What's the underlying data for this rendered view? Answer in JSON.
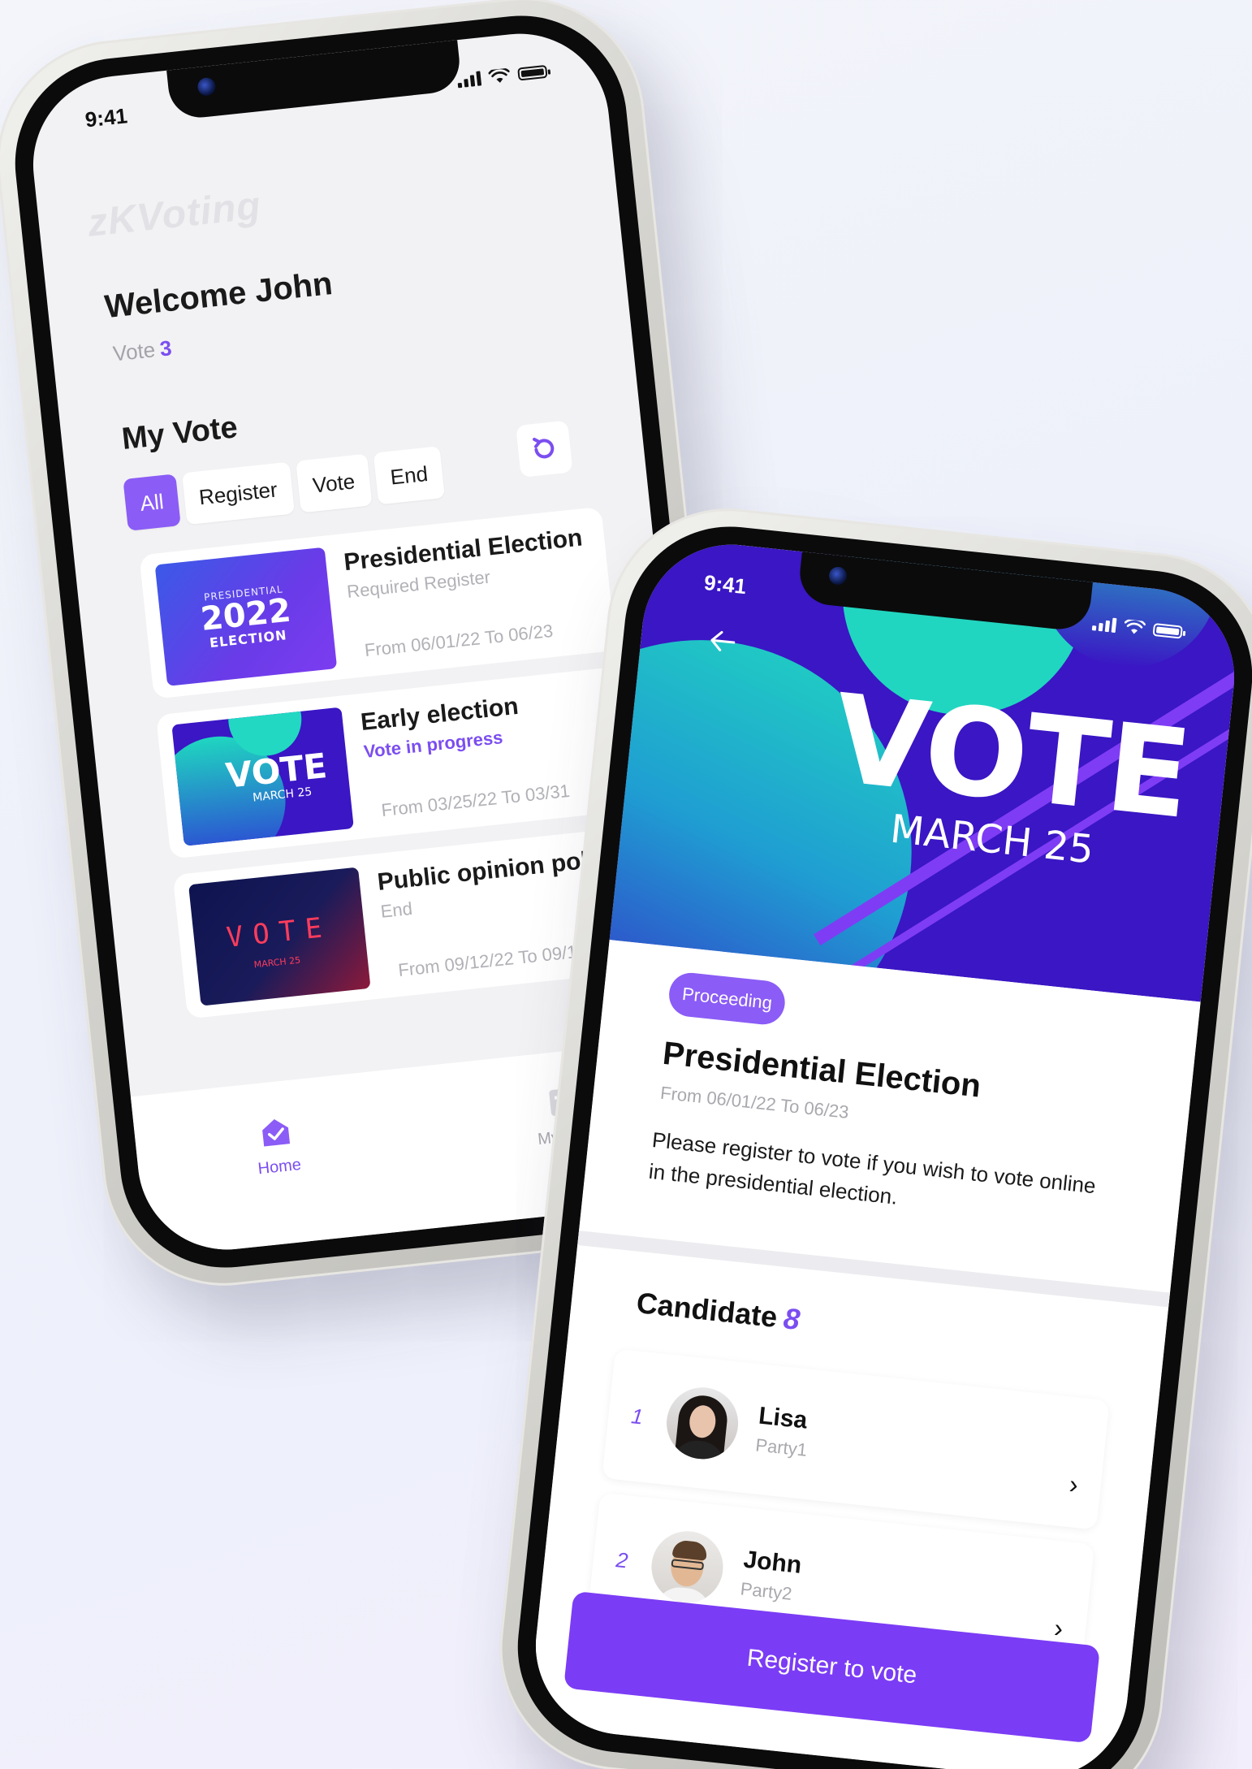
{
  "status_time": "9:41",
  "home": {
    "logo": "zKVoting",
    "welcome": "Welcome John",
    "vote_label": "Vote",
    "vote_count": "3",
    "section_title": "My Vote",
    "filters": [
      "All",
      "Register",
      "Vote",
      "End"
    ],
    "votes": [
      {
        "title": "Presidential Election",
        "status": "Required Register",
        "date": "From 06/01/22 To 06/23",
        "thumb": {
          "line1": "PRESIDENTIAL",
          "line2": "2022",
          "line3": "ELECTION"
        }
      },
      {
        "title": "Early election",
        "status": "Vote in progress",
        "date": "From 03/25/22 To 03/31",
        "thumb": {
          "text": "VOTE",
          "sub": "MARCH 25"
        }
      },
      {
        "title": "Public opinion poll",
        "status": "End",
        "date": "From 09/12/22 To 09/18",
        "thumb": {
          "text": "VOTE",
          "sub": "MARCH 25"
        }
      }
    ],
    "tabs": [
      {
        "label": "Home",
        "icon": "home-check-icon"
      },
      {
        "label": "My Vote",
        "icon": "ballot-icon"
      }
    ]
  },
  "detail": {
    "hero_title": "VOTE",
    "hero_sub": "MARCH 25",
    "badge": "Proceeding",
    "title": "Presidential Election",
    "date": "From 06/01/22 To 06/23",
    "description": "Please register to vote if you wish to vote online in the presidential election.",
    "candidate_label": "Candidate",
    "candidate_count": "8",
    "candidates": [
      {
        "index": "1",
        "name": "Lisa",
        "party": "Party1"
      },
      {
        "index": "2",
        "name": "John",
        "party": "Party2"
      }
    ],
    "register_button": "Register to vote"
  },
  "colors": {
    "accent": "#7b4ef0",
    "hero_bg": "#3a16c4",
    "teal": "#21d6c0"
  }
}
